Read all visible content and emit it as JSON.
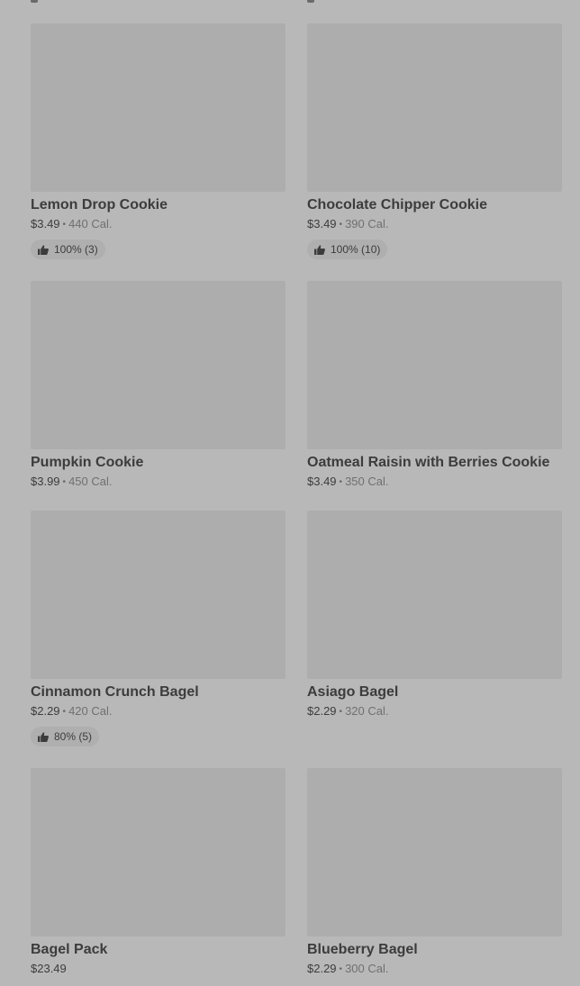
{
  "items": [
    {
      "name": "Lemon Drop Cookie",
      "price": "$3.49",
      "calories": "440 Cal.",
      "rating": "100% (3)"
    },
    {
      "name": "Chocolate Chipper Cookie",
      "price": "$3.49",
      "calories": "390 Cal.",
      "rating": "100% (10)"
    },
    {
      "name": "Pumpkin Cookie",
      "price": "$3.99",
      "calories": "450 Cal.",
      "rating": null
    },
    {
      "name": "Oatmeal Raisin with Berries Cookie",
      "price": "$3.49",
      "calories": "350 Cal.",
      "rating": null
    },
    {
      "name": "Cinnamon Crunch Bagel",
      "price": "$2.29",
      "calories": "420 Cal.",
      "rating": "80% (5)"
    },
    {
      "name": "Asiago Bagel",
      "price": "$2.29",
      "calories": "320 Cal.",
      "rating": null
    },
    {
      "name": "Bagel Pack",
      "price": "$23.49",
      "calories": null,
      "rating": null
    },
    {
      "name": "Blueberry Bagel",
      "price": "$2.29",
      "calories": "300 Cal.",
      "rating": null
    }
  ],
  "icons": {
    "rating": "thumbs-up-icon"
  },
  "colors": {
    "background": "#b8b8b8",
    "image_placeholder": "#adadad",
    "text": "#3c3c3c",
    "muted": "#707070"
  }
}
